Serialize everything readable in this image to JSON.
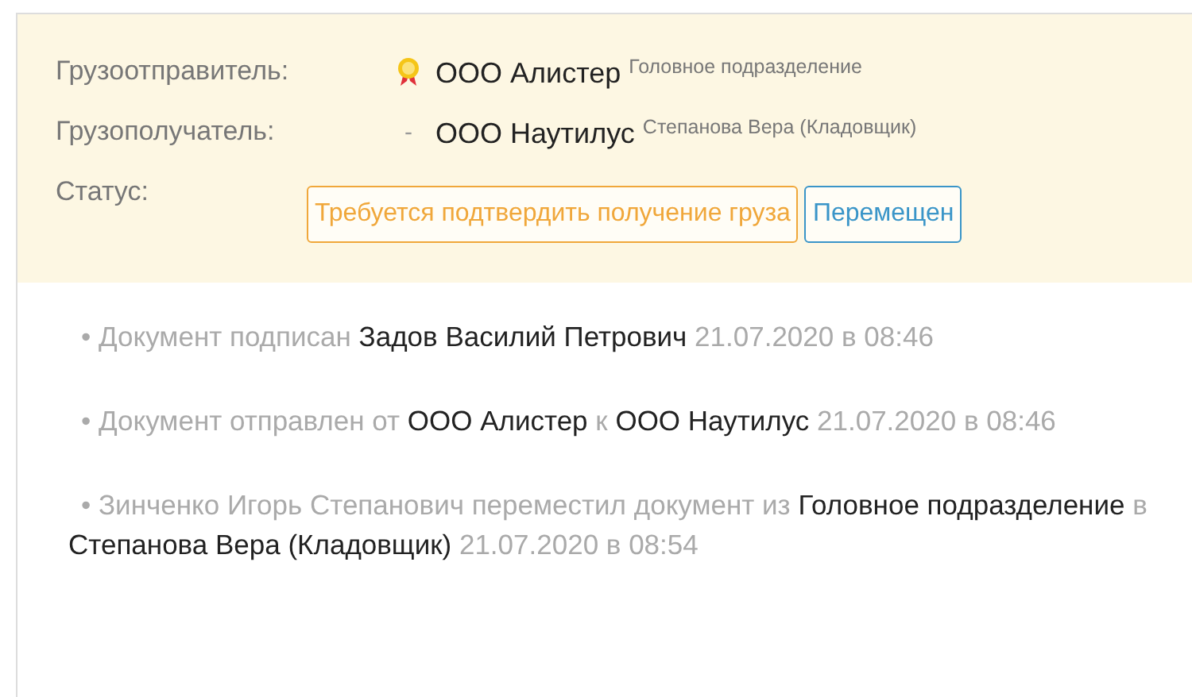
{
  "parties": [
    {
      "label": "Грузоотправитель:",
      "verified": true,
      "name": "ООО Алистер",
      "subtitle": "Головное подразделение"
    },
    {
      "label": "Грузополучатель:",
      "verified": false,
      "marker": "-",
      "name": "ООО Наутилус",
      "subtitle": "Степанова Вера (Кладовщик)"
    }
  ],
  "status": {
    "label": "Статус:",
    "badges": [
      {
        "text": "Требуется подтвердить получение груза",
        "color": "#f0a73a"
      },
      {
        "text": "Перемещен",
        "color": "#3a95c8"
      }
    ]
  },
  "log": [
    {
      "parts": [
        {
          "text": "• Документ подписан",
          "kind": "muted"
        },
        {
          "text": "Задов Василий Петрович",
          "kind": "dark"
        },
        {
          "text": "21.07.2020 в 08:46",
          "kind": "muted"
        }
      ]
    },
    {
      "parts": [
        {
          "text": "• Документ отправлен от",
          "kind": "muted"
        },
        {
          "text": "ООО Алистер",
          "kind": "dark"
        },
        {
          "text": "к",
          "kind": "muted"
        },
        {
          "text": "ООО Наутилус",
          "kind": "dark"
        },
        {
          "text": "21.07.2020 в 08:46",
          "kind": "muted"
        }
      ]
    },
    {
      "parts": [
        {
          "text": "• Зинченко Игорь Степанович переместил документ из",
          "kind": "muted"
        },
        {
          "text": "Головное подразделение",
          "kind": "dark"
        },
        {
          "text": "в",
          "kind": "muted"
        },
        {
          "text": "Степанова Вера (Кладовщик)",
          "kind": "dark"
        },
        {
          "text": "21.07.2020 в 08:54",
          "kind": "muted"
        }
      ]
    }
  ]
}
